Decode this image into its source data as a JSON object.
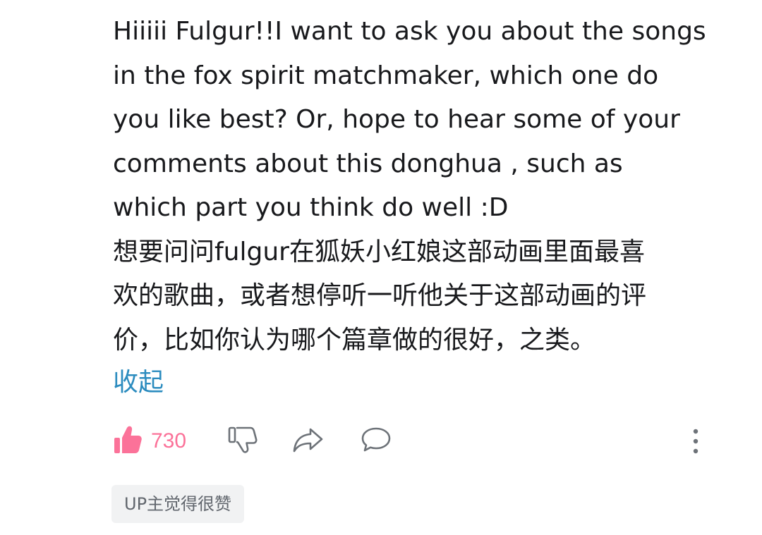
{
  "comment": {
    "lines": [
      "Hiiiii Fulgur!!I want to ask you about the songs",
      "in the fox spirit matchmaker, which one do",
      "you like best? Or, hope to hear some of your",
      "comments about this donghua , such as",
      "which part you think do well :D",
      "想要问问fulgur在狐妖小红娘这部动画里面最喜",
      "欢的歌曲，或者想停听一听他关于这部动画的评",
      "价，比如你认为哪个篇章做的很好，之类。"
    ],
    "collapse_label": "收起"
  },
  "actions": {
    "like_count": "730",
    "like_color": "#fb7299",
    "icons": {
      "like": "thumbs-up-icon",
      "dislike": "thumbs-down-icon",
      "share": "share-arrow-icon",
      "reply": "speech-bubble-icon",
      "more": "more-vertical-icon"
    }
  },
  "badge": {
    "label": "UP主觉得很赞"
  }
}
